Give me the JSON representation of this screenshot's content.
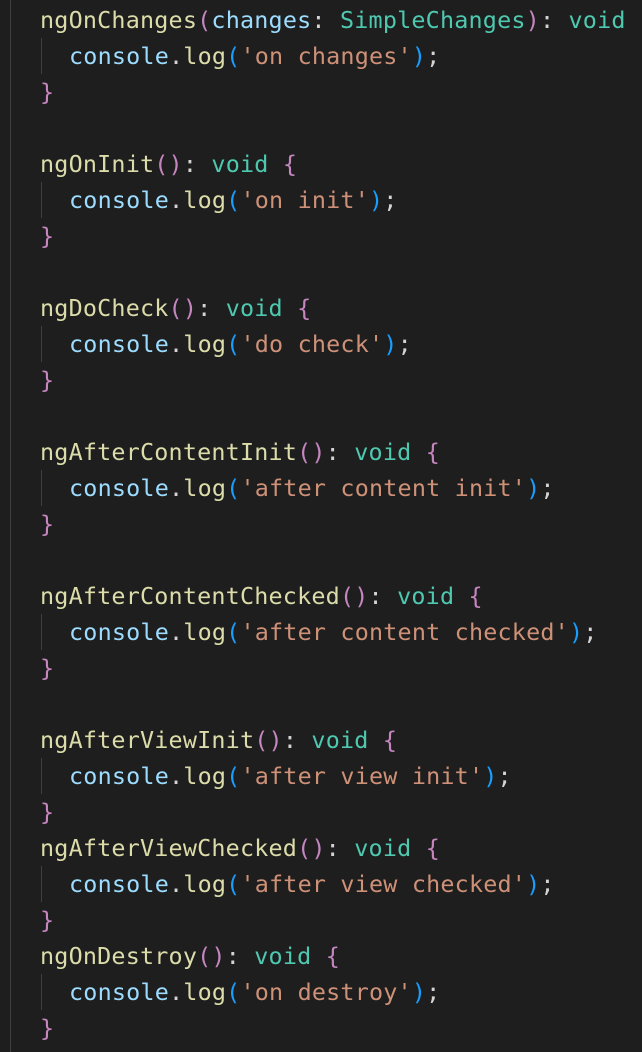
{
  "editor": {
    "methods": [
      {
        "name": "ngOnChanges",
        "param_name": "changes",
        "param_type": "SimpleChanges",
        "return_type": "void",
        "log_object": "console",
        "log_method": "log",
        "message": "'on changes'"
      },
      {
        "name": "ngOnInit",
        "param_name": "",
        "param_type": "",
        "return_type": "void",
        "log_object": "console",
        "log_method": "log",
        "message": "'on init'"
      },
      {
        "name": "ngDoCheck",
        "param_name": "",
        "param_type": "",
        "return_type": "void",
        "log_object": "console",
        "log_method": "log",
        "message": "'do check'"
      },
      {
        "name": "ngAfterContentInit",
        "param_name": "",
        "param_type": "",
        "return_type": "void",
        "log_object": "console",
        "log_method": "log",
        "message": "'after content init'"
      },
      {
        "name": "ngAfterContentChecked",
        "param_name": "",
        "param_type": "",
        "return_type": "void",
        "log_object": "console",
        "log_method": "log",
        "message": "'after content checked'"
      },
      {
        "name": "ngAfterViewInit",
        "param_name": "",
        "param_type": "",
        "return_type": "void",
        "log_object": "console",
        "log_method": "log",
        "message": "'after view init'"
      },
      {
        "name": "ngAfterViewChecked",
        "param_name": "",
        "param_type": "",
        "return_type": "void",
        "log_object": "console",
        "log_method": "log",
        "message": "'after view checked'"
      },
      {
        "name": "ngOnDestroy",
        "param_name": "",
        "param_type": "",
        "return_type": "void",
        "log_object": "console",
        "log_method": "log",
        "message": "'on destroy'"
      }
    ]
  }
}
